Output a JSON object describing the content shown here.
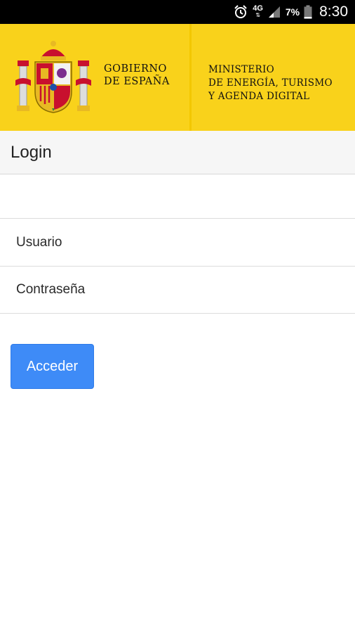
{
  "status_bar": {
    "network": "4G",
    "battery": "7%",
    "time": "8:30",
    "icons": [
      "alarm-icon",
      "signal-icon",
      "battery-icon"
    ]
  },
  "banner": {
    "gov_line1": "GOBIERNO",
    "gov_line2": "DE ESPAÑA",
    "ministry_line1": "MINISTERIO",
    "ministry_line2": "DE ENERGÍA, TURISMO",
    "ministry_line3": "Y AGENDA DIGITAL",
    "background_color": "#f9d21b"
  },
  "toolbar": {
    "title": "Login"
  },
  "form": {
    "username_placeholder": "Usuario",
    "password_placeholder": "Contraseña",
    "submit_label": "Acceder",
    "submit_color": "#3e8bf7"
  }
}
